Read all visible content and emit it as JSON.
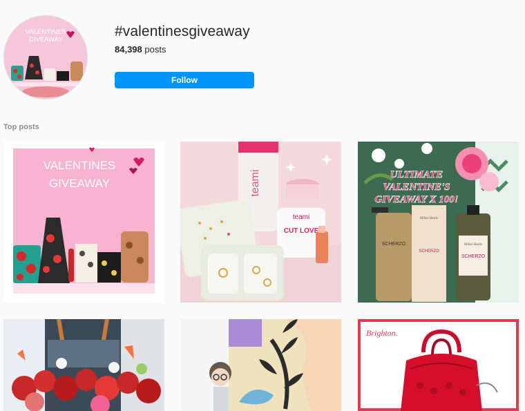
{
  "header": {
    "hashtag": "#valentinesgiveaway",
    "post_count": "84,398",
    "post_suffix": " posts",
    "follow_label": "Follow"
  },
  "avatar": {
    "title_line1": "VALENTINES",
    "title_line2": "GIVEAWAY"
  },
  "section": {
    "title": "Top posts"
  },
  "posts": [
    {
      "title_line1": "VALENTINES",
      "title_line2": "GIVEAWAY"
    },
    {
      "brand": "teami",
      "jar_label": "CUT LOVE"
    },
    {
      "line1": "ULTIMATE",
      "line2": "VALENTINE'S",
      "line3": "GIVEAWAY X 100!",
      "product": "SCHERZO",
      "brand": "Miller Harris"
    },
    {},
    {},
    {
      "brand": "Brighton."
    }
  ],
  "colors": {
    "follow_bg": "#0095f6",
    "pink_bg": "#f7b3cf",
    "muted": "#8e8e8e"
  }
}
